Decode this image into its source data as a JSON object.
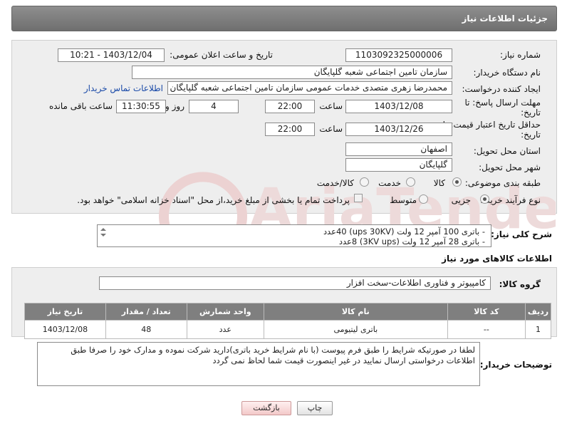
{
  "header": {
    "title": "جزئیات اطلاعات نیاز"
  },
  "form": {
    "need_number": {
      "label": "شماره نیاز:",
      "value": "1103092325000006"
    },
    "announce_date": {
      "label": "تاریخ و ساعت اعلان عمومی:",
      "value": "1403/12/04 - 10:21"
    },
    "buyer_org": {
      "label": "نام دستگاه خریدار:",
      "value": "سازمان تامین اجتماعی شعبه گلپایگان"
    },
    "requester": {
      "label": "ایجاد کننده درخواست:",
      "value": "محمدرضا زهری متصدی خدمات عمومی سازمان تامین اجتماعی شعبه گلپایگان",
      "contact_link": "اطلاعات تماس خریدار"
    },
    "reply_deadline": {
      "label_line1": "مهلت ارسال پاسخ: تا",
      "label_line2": "تاریخ:",
      "date": "1403/12/08",
      "time_label": "ساعت",
      "time": "22:00",
      "days": "4",
      "days_label": "روز و",
      "remaining": "11:30:55",
      "remaining_label": "ساعت باقی مانده"
    },
    "price_validity": {
      "label_line1": "حداقل تاریخ اعتبار قیمت: تا",
      "label_line2": "تاریخ:",
      "date": "1403/12/26",
      "time_label": "ساعت",
      "time": "22:00"
    },
    "province": {
      "label": "استان محل تحویل:",
      "value": "اصفهان"
    },
    "city": {
      "label": "شهر محل تحویل:",
      "value": "گلپایگان"
    },
    "category": {
      "label": "طبقه بندی موضوعی:",
      "options": [
        "کالا",
        "خدمت",
        "کالا/خدمت"
      ],
      "selected": "کالا"
    },
    "process": {
      "label": "نوع فرآیند خرید :",
      "options": [
        "جزیی",
        "متوسط"
      ],
      "selected": "جزیی",
      "payment_note": "پرداخت تمام یا بخشی از مبلغ خرید،از محل \"اسناد خزانه اسلامی\" خواهد بود."
    }
  },
  "description": {
    "label": "شرح کلی نیاز:",
    "lines": [
      "- باتری 100 آمپر 12 ولت (ups 30KV) 40عدد",
      "- باتری 28 آمپر 12 ولت (3KV ups) 8عدد"
    ]
  },
  "goods": {
    "section_title": "اطلاعات کالاهای مورد نیاز",
    "group_label": "گروه کالا:",
    "group_value": "کامپیوتر و فناوری اطلاعات-سخت افزار",
    "columns": [
      "ردیف",
      "کد کالا",
      "نام کالا",
      "واحد شمارش",
      "تعداد / مقدار",
      "تاریخ نیاز"
    ],
    "rows": [
      {
        "row": "1",
        "code": "--",
        "name": "باتری لیتیومی",
        "unit": "عدد",
        "qty": "48",
        "date": "1403/12/08"
      }
    ]
  },
  "buyer_notes": {
    "label": "توضیحات خریدار:",
    "text": "لطفا در صورتیکه شرایط را طبق فرم پیوست (با نام شرایط خرید باتری)دارید شرکت نموده و مدارک خود را صرفا طبق اطلاعات درخواستی ارسال نمایید در غیر اینصورت قیمت شما لحاظ نمی گردد"
  },
  "buttons": {
    "print": "چاپ",
    "back": "بازگشت"
  },
  "watermark": {
    "text": "AriaTender.neT"
  },
  "colors": {
    "header_bg": "#7a7a7a",
    "link": "#1a4aa8",
    "watermark": "#e8c8c8"
  }
}
